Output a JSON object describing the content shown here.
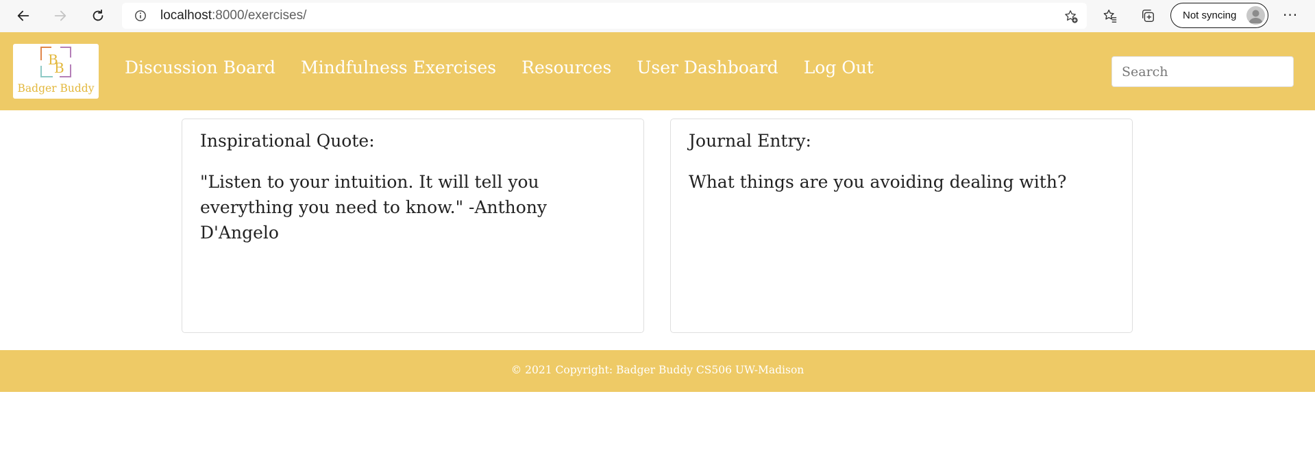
{
  "browser": {
    "url_host": "localhost",
    "url_path": ":8000/exercises/",
    "sync_label": "Not syncing",
    "menu_glyph": "···"
  },
  "site": {
    "logo_label": "Badger Buddy",
    "nav": [
      {
        "label": "Discussion Board"
      },
      {
        "label": "Mindfulness Exercises"
      },
      {
        "label": "Resources"
      },
      {
        "label": "User Dashboard"
      },
      {
        "label": "Log Out"
      }
    ],
    "search_placeholder": "Search"
  },
  "cards": {
    "quote": {
      "title": "Inspirational Quote:",
      "text": "\"Listen to your intuition. It will tell you everything you need to know.\" -Anthony D'Angelo"
    },
    "journal": {
      "title": "Journal Entry:",
      "text": "What things are you avoiding dealing with?"
    }
  },
  "footer": {
    "text": "© 2021 Copyright: Badger Buddy CS506 UW-Madison"
  },
  "colors": {
    "brand_yellow": "#eeca66",
    "logo_orange": "#e0864a",
    "logo_teal": "#8ec9c5",
    "logo_purple": "#b57fb8",
    "logo_gold": "#e3b83d"
  }
}
